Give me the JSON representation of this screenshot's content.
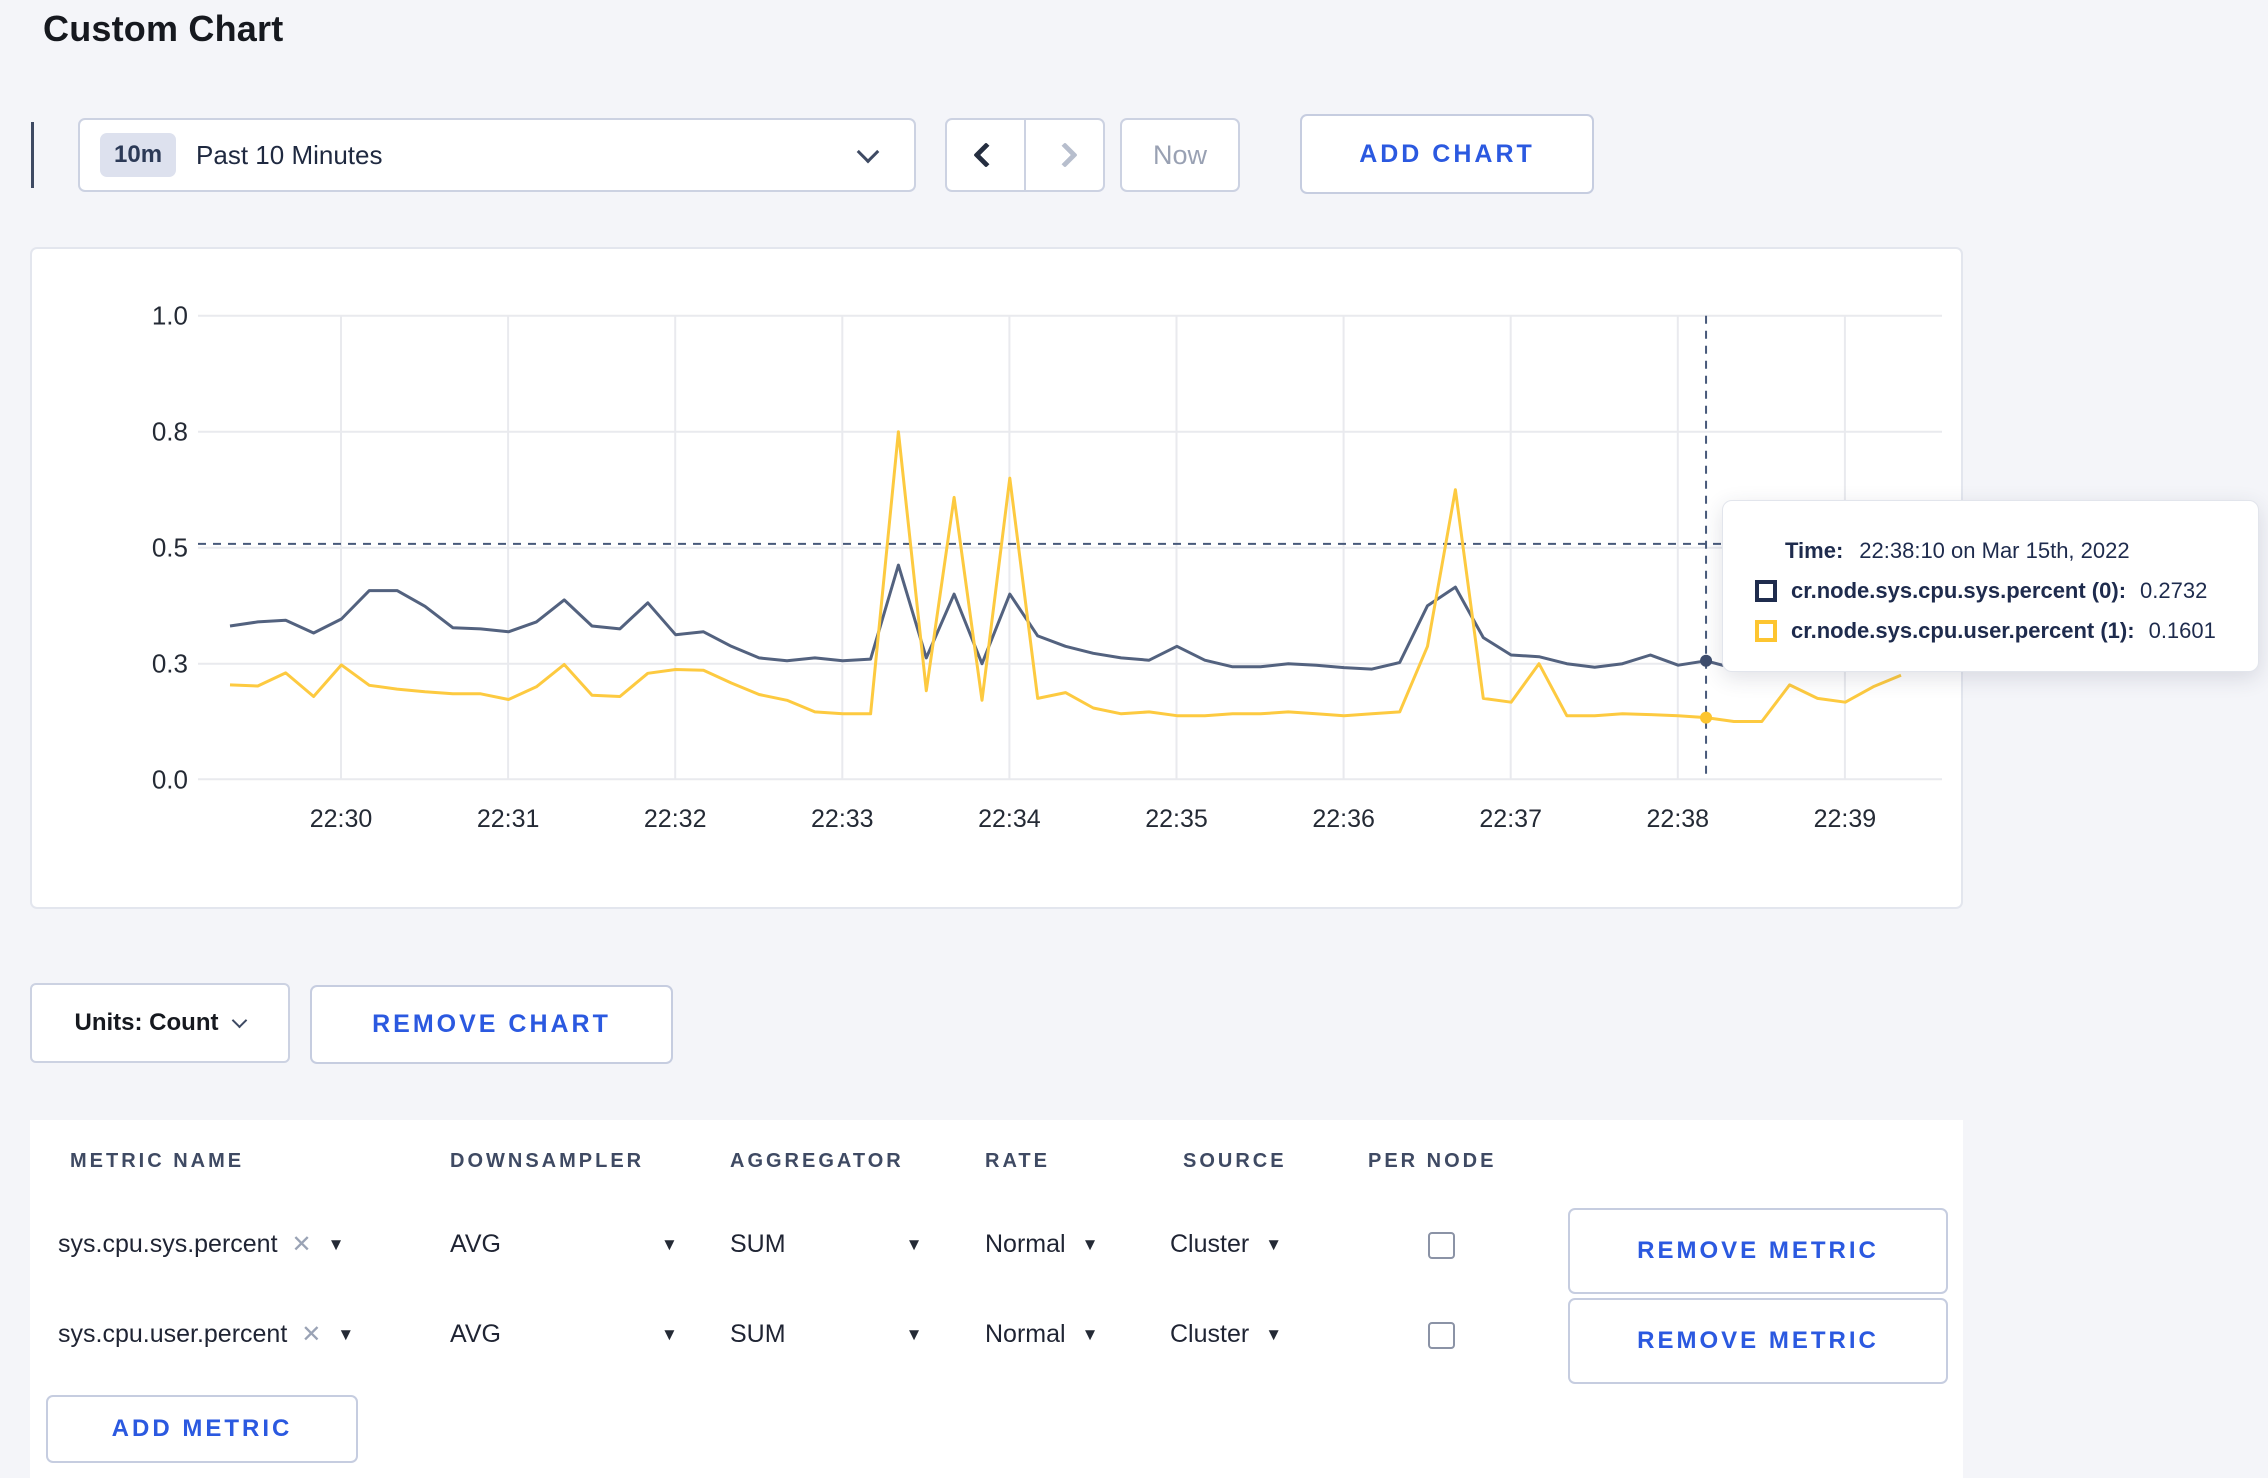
{
  "page": {
    "title": "Custom Chart"
  },
  "toolbar": {
    "time_badge": "10m",
    "time_label": "Past 10 Minutes",
    "prev_label": "previous time window",
    "next_label": "next time window",
    "now_label": "Now",
    "add_chart_label": "ADD CHART"
  },
  "chart_controls": {
    "units_label": "Units: Count",
    "remove_chart_label": "REMOVE CHART",
    "add_metric_label": "ADD METRIC"
  },
  "tooltip": {
    "time_label": "Time:",
    "time_value": "22:38:10 on Mar 15th, 2022",
    "series": [
      {
        "label": "cr.node.sys.cpu.sys.percent (0):",
        "value": "0.2732",
        "color": "#1f2c4d"
      },
      {
        "label": "cr.node.sys.cpu.user.percent (1):",
        "value": "0.1601",
        "color": "#fdc530"
      }
    ]
  },
  "metrics_table": {
    "headers": [
      "METRIC NAME",
      "DOWNSAMPLER",
      "AGGREGATOR",
      "RATE",
      "SOURCE",
      "PER NODE"
    ],
    "remove_metric_label": "REMOVE METRIC",
    "rows": [
      {
        "metric_name": "sys.cpu.sys.percent",
        "downsampler": "AVG",
        "aggregator": "SUM",
        "rate": "Normal",
        "source": "Cluster",
        "per_node_checked": false
      },
      {
        "metric_name": "sys.cpu.user.percent",
        "downsampler": "AVG",
        "aggregator": "SUM",
        "rate": "Normal",
        "source": "Cluster",
        "per_node_checked": false
      }
    ]
  },
  "chart_data": {
    "type": "line",
    "title": "",
    "xlabel": "",
    "ylabel": "",
    "ylim": [
      0.0,
      1.0
    ],
    "grid": true,
    "y_ticks": [
      0.0,
      0.3,
      0.5,
      0.8,
      1.0
    ],
    "x_tick_labels": [
      "22:30",
      "22:31",
      "22:32",
      "22:33",
      "22:34",
      "22:35",
      "22:36",
      "22:37",
      "22:38",
      "22:39"
    ],
    "start_time": "22:29:20",
    "sample_interval_seconds": 10,
    "series": [
      {
        "name": "cr.node.sys.cpu.sys.percent",
        "color": "#53627f",
        "values": [
          0.365,
          0.372,
          0.375,
          0.353,
          0.377,
          0.426,
          0.426,
          0.399,
          0.362,
          0.36,
          0.355,
          0.372,
          0.41,
          0.365,
          0.36,
          0.405,
          0.35,
          0.355,
          0.33,
          0.31,
          0.305,
          0.31,
          0.305,
          0.308,
          0.47,
          0.31,
          0.42,
          0.3,
          0.42,
          0.348,
          0.33,
          0.318,
          0.31,
          0.306,
          0.33,
          0.306,
          0.292,
          0.292,
          0.3,
          0.296,
          0.29,
          0.286,
          0.302,
          0.4,
          0.432,
          0.345,
          0.315,
          0.312,
          0.3,
          0.291,
          0.3,
          0.315,
          0.296,
          0.305,
          0.288,
          0.29,
          0.3,
          0.305,
          0.3,
          0.298,
          0.3
        ]
      },
      {
        "name": "cr.node.sys.cpu.user.percent",
        "color": "#fdca40",
        "values": [
          0.245,
          0.242,
          0.276,
          0.215,
          0.297,
          0.244,
          0.234,
          0.227,
          0.222,
          0.222,
          0.207,
          0.24,
          0.298,
          0.218,
          0.215,
          0.275,
          0.285,
          0.283,
          0.25,
          0.22,
          0.205,
          0.175,
          0.17,
          0.17,
          0.8,
          0.23,
          0.63,
          0.205,
          0.68,
          0.21,
          0.225,
          0.185,
          0.17,
          0.175,
          0.165,
          0.165,
          0.17,
          0.17,
          0.175,
          0.17,
          0.165,
          0.17,
          0.175,
          0.33,
          0.65,
          0.21,
          0.2,
          0.3,
          0.165,
          0.165,
          0.17,
          0.168,
          0.165,
          0.16,
          0.15,
          0.15,
          0.245,
          0.21,
          0.2,
          0.24,
          0.27
        ]
      }
    ],
    "crosshair": {
      "time": "22:38:10",
      "index": 53,
      "hline_value": 0.51
    },
    "legend_position": "tooltip"
  }
}
